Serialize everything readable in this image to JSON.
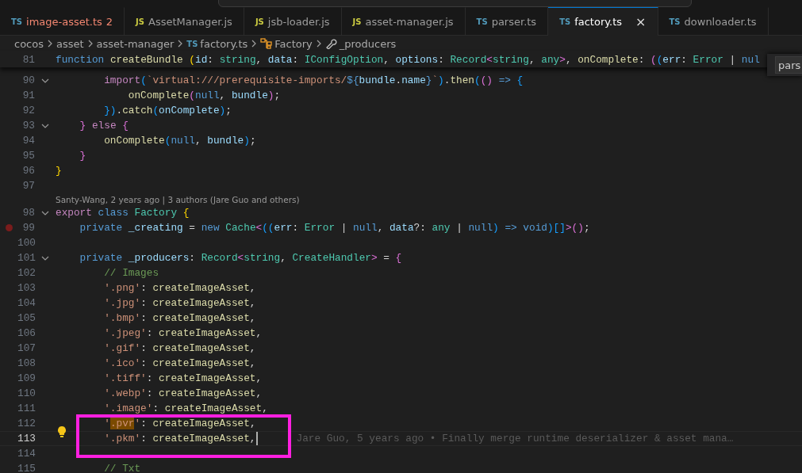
{
  "tabs": [
    {
      "icon_text": "TS",
      "kind": "ts",
      "label": "image-asset.ts",
      "problems": "2",
      "error": true,
      "selected": false
    },
    {
      "icon_text": "JS",
      "kind": "js",
      "label": "AssetManager.js",
      "error": false,
      "selected": false
    },
    {
      "icon_text": "JS",
      "kind": "js",
      "label": "jsb-loader.js",
      "error": false,
      "selected": false
    },
    {
      "icon_text": "JS",
      "kind": "js",
      "label": "asset-manager.js",
      "error": false,
      "selected": false
    },
    {
      "icon_text": "TS",
      "kind": "ts",
      "label": "parser.ts",
      "error": false,
      "selected": false
    },
    {
      "icon_text": "TS",
      "kind": "ts",
      "label": "factory.ts",
      "close": "×",
      "error": false,
      "selected": true
    },
    {
      "icon_text": "TS",
      "kind": "ts",
      "label": "downloader.ts",
      "error": false,
      "selected": false
    }
  ],
  "breadcrumbs": [
    {
      "kind": "folder",
      "label": "cocos"
    },
    {
      "kind": "folder",
      "label": "asset"
    },
    {
      "kind": "folder",
      "label": "asset-manager"
    },
    {
      "kind": "file",
      "icon_text": "TS",
      "label": "factory.ts"
    },
    {
      "kind": "class",
      "label": "Factory"
    },
    {
      "kind": "property",
      "label": "_producers"
    }
  ],
  "find_widget": {
    "value": "pars"
  },
  "sticky_line": {
    "number": "81",
    "tokens": [
      {
        "kind": "kw",
        "t": "function "
      },
      {
        "kind": "fn",
        "t": "createBundle "
      },
      {
        "kind": "b1",
        "t": "("
      },
      {
        "kind": "var",
        "t": "id"
      },
      {
        "kind": "p",
        "t": ": "
      },
      {
        "kind": "type",
        "t": "string"
      },
      {
        "kind": "p",
        "t": ", "
      },
      {
        "kind": "var",
        "t": "data"
      },
      {
        "kind": "p",
        "t": ": "
      },
      {
        "kind": "type",
        "t": "IConfigOption"
      },
      {
        "kind": "p",
        "t": ", "
      },
      {
        "kind": "var",
        "t": "options"
      },
      {
        "kind": "p",
        "t": ": "
      },
      {
        "kind": "type",
        "t": "Record"
      },
      {
        "kind": "b2",
        "t": "<"
      },
      {
        "kind": "type",
        "t": "string"
      },
      {
        "kind": "p",
        "t": ", "
      },
      {
        "kind": "type",
        "t": "any"
      },
      {
        "kind": "b2",
        "t": ">"
      },
      {
        "kind": "p",
        "t": ", "
      },
      {
        "kind": "fn",
        "t": "onComplete"
      },
      {
        "kind": "p",
        "t": ": "
      },
      {
        "kind": "b2",
        "t": "("
      },
      {
        "kind": "b3",
        "t": "("
      },
      {
        "kind": "var",
        "t": "err"
      },
      {
        "kind": "p",
        "t": ": "
      },
      {
        "kind": "type",
        "t": "Error"
      },
      {
        "kind": "p",
        "t": " | "
      },
      {
        "kind": "kw",
        "t": "nul"
      }
    ]
  },
  "lines": [
    {
      "kind": "code",
      "number": "90",
      "fold": true,
      "breakpoint": false,
      "current": false,
      "tokens": [
        {
          "kind": "ctl",
          "t": "        import"
        },
        {
          "kind": "b3",
          "t": "("
        },
        {
          "kind": "str",
          "t": "`virtual:///prerequisite-imports/"
        },
        {
          "kind": "kw",
          "t": "${"
        },
        {
          "kind": "var",
          "t": "bundle"
        },
        {
          "kind": "p",
          "t": "."
        },
        {
          "kind": "var",
          "t": "name"
        },
        {
          "kind": "kw",
          "t": "}"
        },
        {
          "kind": "str",
          "t": "`"
        },
        {
          "kind": "b3",
          "t": ")"
        },
        {
          "kind": "p",
          "t": "."
        },
        {
          "kind": "fn",
          "t": "then"
        },
        {
          "kind": "b3",
          "t": "("
        },
        {
          "kind": "b2",
          "t": "() "
        },
        {
          "kind": "kw",
          "t": "=> "
        },
        {
          "kind": "b3",
          "t": "{"
        }
      ]
    },
    {
      "kind": "code",
      "number": "91",
      "fold": false,
      "breakpoint": false,
      "current": false,
      "tokens": [
        {
          "kind": "fn",
          "t": "            onComplete"
        },
        {
          "kind": "b2",
          "t": "("
        },
        {
          "kind": "kw",
          "t": "null"
        },
        {
          "kind": "p",
          "t": ", "
        },
        {
          "kind": "var",
          "t": "bundle"
        },
        {
          "kind": "b2",
          "t": ")"
        },
        {
          "kind": "p",
          "t": ";"
        }
      ]
    },
    {
      "kind": "code",
      "number": "92",
      "fold": false,
      "breakpoint": false,
      "current": false,
      "tokens": [
        {
          "kind": "b3",
          "t": "        })"
        },
        {
          "kind": "p",
          "t": "."
        },
        {
          "kind": "fn",
          "t": "catch"
        },
        {
          "kind": "b3",
          "t": "("
        },
        {
          "kind": "var",
          "t": "onComplete"
        },
        {
          "kind": "b3",
          "t": ")"
        },
        {
          "kind": "p",
          "t": ";"
        }
      ]
    },
    {
      "kind": "code",
      "number": "93",
      "fold": true,
      "breakpoint": false,
      "current": false,
      "tokens": [
        {
          "kind": "b2",
          "t": "    } "
        },
        {
          "kind": "ctl",
          "t": "else "
        },
        {
          "kind": "b2",
          "t": "{"
        }
      ]
    },
    {
      "kind": "code",
      "number": "94",
      "fold": false,
      "breakpoint": false,
      "current": false,
      "tokens": [
        {
          "kind": "fn",
          "t": "        onComplete"
        },
        {
          "kind": "b3",
          "t": "("
        },
        {
          "kind": "kw",
          "t": "null"
        },
        {
          "kind": "p",
          "t": ", "
        },
        {
          "kind": "var",
          "t": "bundle"
        },
        {
          "kind": "b3",
          "t": ")"
        },
        {
          "kind": "p",
          "t": ";"
        }
      ]
    },
    {
      "kind": "code",
      "number": "95",
      "fold": false,
      "breakpoint": false,
      "current": false,
      "tokens": [
        {
          "kind": "b2",
          "t": "    }"
        }
      ]
    },
    {
      "kind": "code",
      "number": "96",
      "fold": false,
      "breakpoint": false,
      "current": false,
      "tokens": [
        {
          "kind": "b1",
          "t": "}"
        }
      ]
    },
    {
      "kind": "code",
      "number": "97",
      "fold": false,
      "breakpoint": false,
      "current": false
    },
    {
      "kind": "codelens",
      "text": "Santy-Wang, 2 years ago | 3 authors (Jare Guo and others)"
    },
    {
      "kind": "code",
      "number": "98",
      "fold": true,
      "breakpoint": false,
      "current": false,
      "tokens": [
        {
          "kind": "ctl",
          "t": "export "
        },
        {
          "kind": "kw",
          "t": "class "
        },
        {
          "kind": "type",
          "t": "Factory "
        },
        {
          "kind": "b1",
          "t": "{"
        }
      ]
    },
    {
      "kind": "code",
      "number": "99",
      "fold": false,
      "breakpoint": true,
      "current": false,
      "tokens": [
        {
          "kind": "kw",
          "t": "    private "
        },
        {
          "kind": "var",
          "t": "_creating"
        },
        {
          "kind": "p",
          "t": " = "
        },
        {
          "kind": "kw",
          "t": "new "
        },
        {
          "kind": "type",
          "t": "Cache"
        },
        {
          "kind": "b2",
          "t": "<"
        },
        {
          "kind": "b3",
          "t": "(("
        },
        {
          "kind": "var",
          "t": "err"
        },
        {
          "kind": "p",
          "t": ": "
        },
        {
          "kind": "type",
          "t": "Error"
        },
        {
          "kind": "p",
          "t": " | "
        },
        {
          "kind": "kw",
          "t": "null"
        },
        {
          "kind": "p",
          "t": ", "
        },
        {
          "kind": "var",
          "t": "data"
        },
        {
          "kind": "p",
          "t": "?: "
        },
        {
          "kind": "type",
          "t": "any"
        },
        {
          "kind": "p",
          "t": " | "
        },
        {
          "kind": "kw",
          "t": "null"
        },
        {
          "kind": "b3",
          "t": ") "
        },
        {
          "kind": "kw",
          "t": "=> void"
        },
        {
          "kind": "b3",
          "t": ")[]"
        },
        {
          "kind": "b2",
          "t": ">"
        },
        {
          "kind": "b2",
          "t": "()"
        },
        {
          "kind": "p",
          "t": ";"
        }
      ]
    },
    {
      "kind": "code",
      "number": "100",
      "fold": false,
      "breakpoint": false,
      "current": false
    },
    {
      "kind": "code",
      "number": "101",
      "fold": true,
      "breakpoint": false,
      "current": false,
      "tokens": [
        {
          "kind": "kw",
          "t": "    private "
        },
        {
          "kind": "var",
          "t": "_producers"
        },
        {
          "kind": "p",
          "t": ": "
        },
        {
          "kind": "type",
          "t": "Record"
        },
        {
          "kind": "b2",
          "t": "<"
        },
        {
          "kind": "type",
          "t": "string"
        },
        {
          "kind": "p",
          "t": ", "
        },
        {
          "kind": "type",
          "t": "CreateHandler"
        },
        {
          "kind": "b2",
          "t": ">"
        },
        {
          "kind": "p",
          "t": " = "
        },
        {
          "kind": "b2",
          "t": "{"
        }
      ]
    },
    {
      "kind": "code",
      "number": "102",
      "fold": false,
      "breakpoint": false,
      "current": false,
      "tokens": [
        {
          "kind": "cmt",
          "t": "        // Images"
        }
      ]
    },
    {
      "kind": "code",
      "number": "103",
      "fold": false,
      "breakpoint": false,
      "current": false,
      "tokens": [
        {
          "kind": "str",
          "t": "        '.png'"
        },
        {
          "kind": "p",
          "t": ": "
        },
        {
          "kind": "fn",
          "t": "createImageAsset"
        },
        {
          "kind": "p",
          "t": ","
        }
      ]
    },
    {
      "kind": "code",
      "number": "104",
      "fold": false,
      "breakpoint": false,
      "current": false,
      "tokens": [
        {
          "kind": "str",
          "t": "        '.jpg'"
        },
        {
          "kind": "p",
          "t": ": "
        },
        {
          "kind": "fn",
          "t": "createImageAsset"
        },
        {
          "kind": "p",
          "t": ","
        }
      ]
    },
    {
      "kind": "code",
      "number": "105",
      "fold": false,
      "breakpoint": false,
      "current": false,
      "tokens": [
        {
          "kind": "str",
          "t": "        '.bmp'"
        },
        {
          "kind": "p",
          "t": ": "
        },
        {
          "kind": "fn",
          "t": "createImageAsset"
        },
        {
          "kind": "p",
          "t": ","
        }
      ]
    },
    {
      "kind": "code",
      "number": "106",
      "fold": false,
      "breakpoint": false,
      "current": false,
      "tokens": [
        {
          "kind": "str",
          "t": "        '.jpeg'"
        },
        {
          "kind": "p",
          "t": ": "
        },
        {
          "kind": "fn",
          "t": "createImageAsset"
        },
        {
          "kind": "p",
          "t": ","
        }
      ]
    },
    {
      "kind": "code",
      "number": "107",
      "fold": false,
      "breakpoint": false,
      "current": false,
      "tokens": [
        {
          "kind": "str",
          "t": "        '.gif'"
        },
        {
          "kind": "p",
          "t": ": "
        },
        {
          "kind": "fn",
          "t": "createImageAsset"
        },
        {
          "kind": "p",
          "t": ","
        }
      ]
    },
    {
      "kind": "code",
      "number": "108",
      "fold": false,
      "breakpoint": false,
      "current": false,
      "tokens": [
        {
          "kind": "str",
          "t": "        '.ico'"
        },
        {
          "kind": "p",
          "t": ": "
        },
        {
          "kind": "fn",
          "t": "createImageAsset"
        },
        {
          "kind": "p",
          "t": ","
        }
      ]
    },
    {
      "kind": "code",
      "number": "109",
      "fold": false,
      "breakpoint": false,
      "current": false,
      "tokens": [
        {
          "kind": "str",
          "t": "        '.tiff'"
        },
        {
          "kind": "p",
          "t": ": "
        },
        {
          "kind": "fn",
          "t": "createImageAsset"
        },
        {
          "kind": "p",
          "t": ","
        }
      ]
    },
    {
      "kind": "code",
      "number": "110",
      "fold": false,
      "breakpoint": false,
      "current": false,
      "tokens": [
        {
          "kind": "str",
          "t": "        '.webp'"
        },
        {
          "kind": "p",
          "t": ": "
        },
        {
          "kind": "fn",
          "t": "createImageAsset"
        },
        {
          "kind": "p",
          "t": ","
        }
      ]
    },
    {
      "kind": "code",
      "number": "111",
      "fold": false,
      "breakpoint": false,
      "current": false,
      "tokens": [
        {
          "kind": "str",
          "t": "        '.image'"
        },
        {
          "kind": "p",
          "t": ": "
        },
        {
          "kind": "fn",
          "t": "createImageAsset"
        },
        {
          "kind": "p",
          "t": ","
        }
      ]
    },
    {
      "kind": "code",
      "number": "112",
      "fold": false,
      "breakpoint": false,
      "current": false,
      "tokens": [
        {
          "kind": "str",
          "t": "        '"
        },
        {
          "kind": "hl",
          "t": ".pvr"
        },
        {
          "kind": "str",
          "t": "'"
        },
        {
          "kind": "p",
          "t": ": "
        },
        {
          "kind": "fn",
          "t": "createImageAsset"
        },
        {
          "kind": "p",
          "t": ","
        }
      ]
    },
    {
      "kind": "code",
      "number": "113",
      "fold": false,
      "breakpoint": false,
      "current": true,
      "blame": "Jare Guo, 5 years ago • Finally merge runtime deserializer & asset mana…",
      "tokens": [
        {
          "kind": "str",
          "t": "        '.pkm'"
        },
        {
          "kind": "p",
          "t": ": "
        },
        {
          "kind": "fn",
          "t": "createImageAsset"
        },
        {
          "kind": "p",
          "t": ","
        }
      ]
    },
    {
      "kind": "code",
      "number": "114",
      "fold": false,
      "breakpoint": false,
      "current": false
    },
    {
      "kind": "code",
      "number": "115",
      "fold": false,
      "breakpoint": false,
      "current": false,
      "tokens": [
        {
          "kind": "cmt",
          "t": "        // Txt"
        }
      ]
    }
  ]
}
